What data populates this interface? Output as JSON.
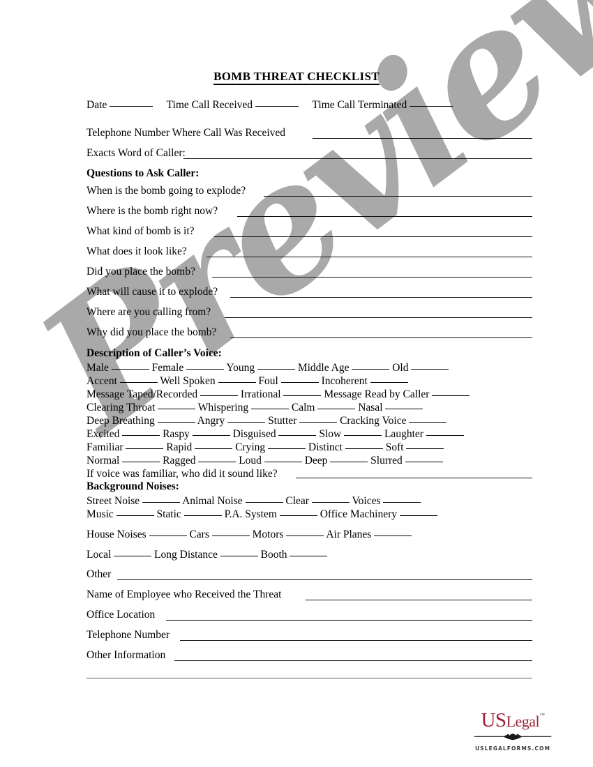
{
  "document": {
    "title": "BOMB THREAT CHECKLIST",
    "watermark": "Preview"
  },
  "header_row": {
    "date_label": "Date",
    "time_received_label": "Time Call Received",
    "time_terminated_label": "Time Call Terminated"
  },
  "top_fields": [
    {
      "label": "Telephone Number Where Call Was Received"
    },
    {
      "label": "Exacts Word of Caller:"
    }
  ],
  "questions_section": {
    "heading": "Questions to Ask Caller:",
    "questions": [
      "When is the bomb going to explode?",
      "Where is the bomb right now?",
      "What kind of bomb is it?",
      "What does it look like?",
      "Did you place the bomb?",
      "What will cause it to explode?",
      "Where are you calling from?",
      "Why did you place the bomb?"
    ]
  },
  "voice_section": {
    "heading": "Description of Caller’s Voice:",
    "rows": [
      [
        "Male",
        "Female",
        "Young",
        "Middle Age",
        "Old"
      ],
      [
        "Accent",
        "Well Spoken",
        "Foul",
        "Incoherent"
      ],
      [
        "Message Taped/Recorded",
        "Irrational",
        "Message Read by Caller"
      ],
      [
        "Clearing Throat",
        "Whispering",
        "Calm",
        "Nasal"
      ],
      [
        "Deep Breathing",
        "Angry",
        "Stutter",
        "Cracking Voice"
      ],
      [
        "Excited",
        "Raspy",
        "Disguised",
        "Slow",
        "Laughter"
      ],
      [
        "Familiar",
        "Rapid",
        "Crying",
        "Distinct",
        "Soft"
      ],
      [
        "Normal",
        "Ragged",
        "Loud",
        "Deep",
        "Slurred"
      ]
    ],
    "familiar_question": "If voice was familiar, who did it sound like?"
  },
  "background_section": {
    "heading": "Background Noises:",
    "rows": [
      [
        "Street Noise",
        "Animal Noise",
        "Clear",
        "Voices"
      ],
      [
        "Music",
        "Static",
        "P.A. System",
        "Office Machinery"
      ],
      [
        "House Noises",
        "Cars",
        "Motors",
        "Air Planes"
      ],
      [
        "Local",
        "Long Distance",
        "Booth"
      ]
    ]
  },
  "footer_fields": [
    {
      "label": "Other"
    },
    {
      "label": "Name of Employee who Received the Threat"
    },
    {
      "label": "Office Location"
    },
    {
      "label": "Telephone Number"
    },
    {
      "label": "Other Information"
    }
  ],
  "logo": {
    "us": "US",
    "legal": "Legal",
    "trademark": "™",
    "tagline": "USLEGALFORMS.COM",
    "color": "#9b2335"
  }
}
